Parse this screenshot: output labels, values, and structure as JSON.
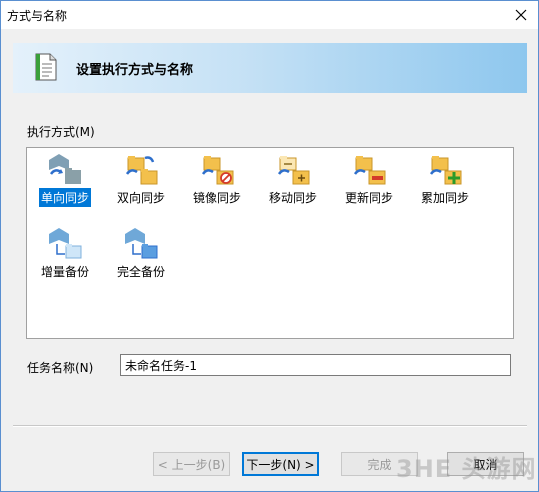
{
  "window": {
    "title": "方式与名称",
    "close_glyph": "✕"
  },
  "banner": {
    "title": "设置执行方式与名称",
    "icon": "document-icon"
  },
  "mode": {
    "label": "执行方式(M)",
    "items": [
      {
        "label": "单向同步",
        "icon": "one-way-sync-icon",
        "selected": true
      },
      {
        "label": "双向同步",
        "icon": "two-way-sync-icon",
        "selected": false
      },
      {
        "label": "镜像同步",
        "icon": "mirror-sync-icon",
        "selected": false
      },
      {
        "label": "移动同步",
        "icon": "move-sync-icon",
        "selected": false
      },
      {
        "label": "更新同步",
        "icon": "update-sync-icon",
        "selected": false
      },
      {
        "label": "累加同步",
        "icon": "cumulative-sync-icon",
        "selected": false
      },
      {
        "label": "增量备份",
        "icon": "incremental-backup-icon",
        "selected": false
      },
      {
        "label": "完全备份",
        "icon": "full-backup-icon",
        "selected": false
      }
    ]
  },
  "task_name": {
    "label": "任务名称(N)",
    "value": "未命名任务-1"
  },
  "buttons": {
    "back": "< 上一步(B)",
    "next": "下一步(N) >",
    "finish": "完成",
    "cancel": "取消"
  },
  "watermark": "3HE 头游网",
  "colors": {
    "selection": "#0078d7",
    "banner_end": "#8ec7ee",
    "folder": "#f3c04c",
    "arrow": "#2e6fcc"
  }
}
